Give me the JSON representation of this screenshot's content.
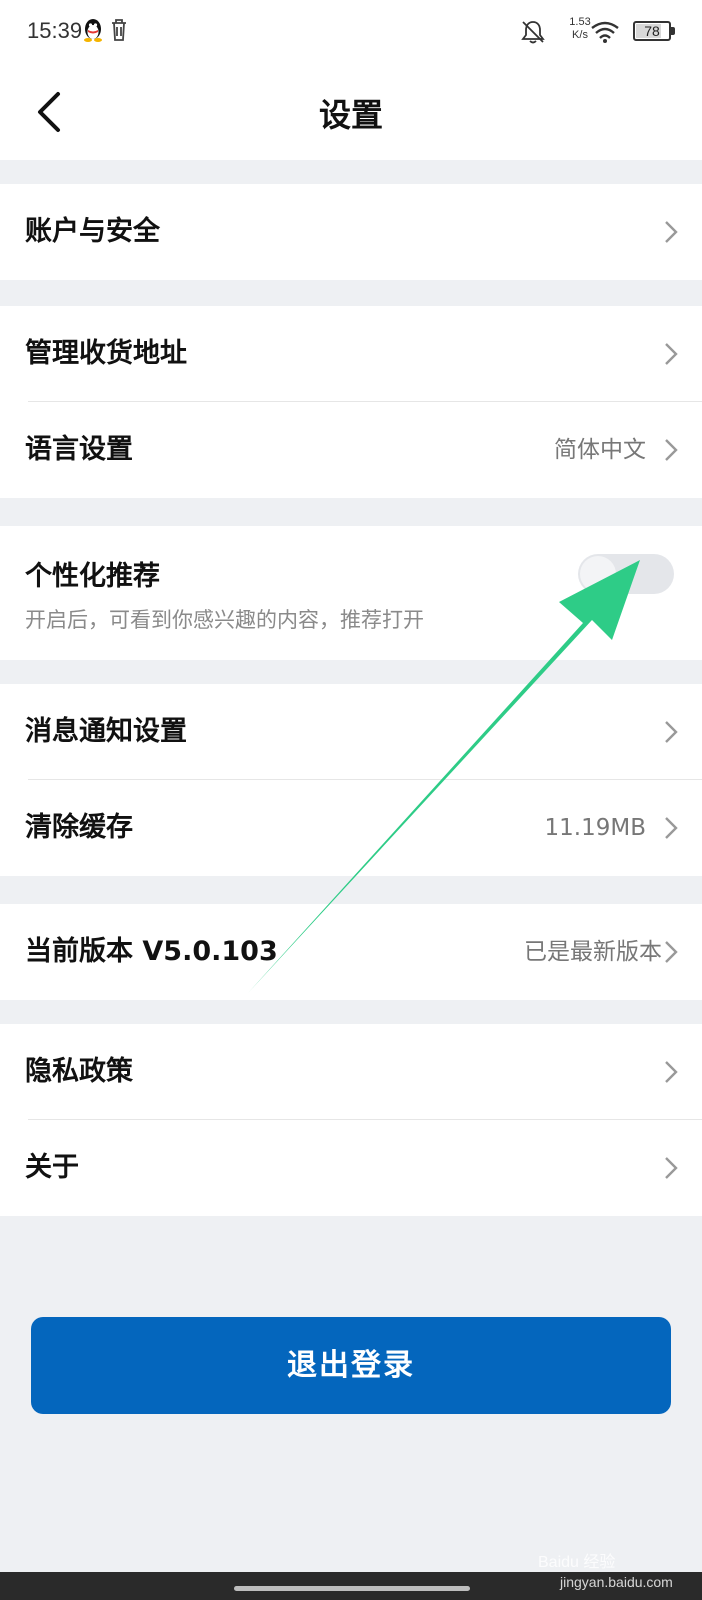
{
  "status_bar": {
    "time": "15:39",
    "net_speed_value": "1.53",
    "net_speed_unit": "K/s",
    "battery": "78",
    "icons": [
      "qq-penguin-icon",
      "trash-icon",
      "bell-muted-icon",
      "wifi-icon",
      "battery-icon"
    ]
  },
  "nav": {
    "title": "设置",
    "back_icon": "chevron-left-icon"
  },
  "settings": {
    "account_security": {
      "label": "账户与安全"
    },
    "address": {
      "label": "管理收货地址"
    },
    "language": {
      "label": "语言设置",
      "value": "简体中文"
    },
    "recommend": {
      "label": "个性化推荐",
      "description": "开启后，可看到你感兴趣的内容，推荐打开",
      "toggle_on": false
    },
    "notifications": {
      "label": "消息通知设置"
    },
    "cache": {
      "label": "清除缓存",
      "value": "11.19MB"
    },
    "version": {
      "label": "当前版本 V5.0.103",
      "value": "已是最新版本"
    },
    "privacy": {
      "label": "隐私政策"
    },
    "about": {
      "label": "关于"
    }
  },
  "logout": {
    "label": "退出登录"
  },
  "watermark": {
    "brand": "Baidu 经验",
    "url": "jingyan.baidu.com"
  },
  "colors": {
    "page_bg": "#eef0f3",
    "primary": "#0466bd",
    "annotation_arrow": "#2ecc87",
    "secondary_text": "#777777"
  }
}
